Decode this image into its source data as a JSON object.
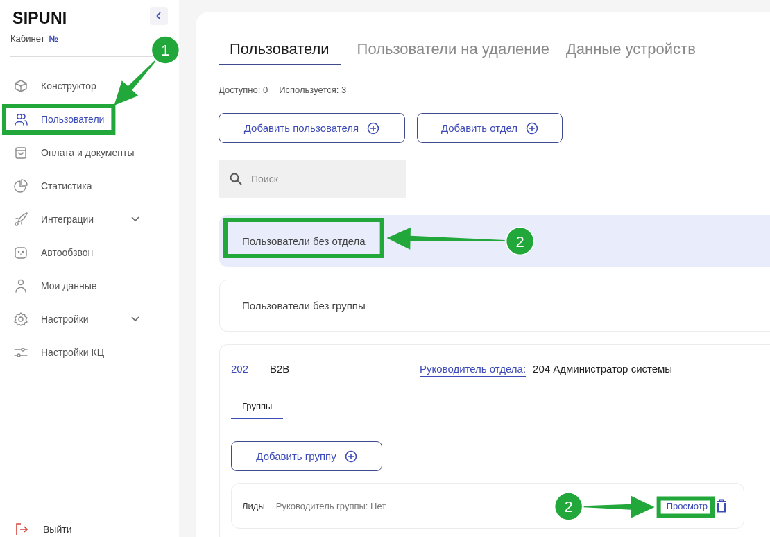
{
  "sidebar": {
    "logo": "SIPUNI",
    "account": {
      "label": "Кабинет",
      "sign": "№"
    },
    "nav": [
      {
        "label": "Конструктор",
        "kind": "link",
        "selected": false
      },
      {
        "label": "Пользователи",
        "kind": "link",
        "selected": true
      },
      {
        "label": "Оплата и документы",
        "kind": "link",
        "selected": false
      },
      {
        "label": "Статистика",
        "kind": "link",
        "selected": false
      },
      {
        "label": "Интеграции",
        "kind": "group",
        "selected": false,
        "expanded": false
      },
      {
        "label": "Автообзвон",
        "kind": "link",
        "selected": false
      },
      {
        "label": "Мои данные",
        "kind": "link",
        "selected": false
      },
      {
        "label": "Настройки",
        "kind": "group",
        "selected": false,
        "expanded": false
      },
      {
        "label": "Настройки КЦ",
        "kind": "link",
        "selected": false
      }
    ],
    "logout": "Выйти"
  },
  "tabs": [
    {
      "label": "Пользователи",
      "selected": true
    },
    {
      "label": "Пользователи на удаление",
      "selected": false
    },
    {
      "label": "Данные устройств",
      "selected": false
    }
  ],
  "counters": [
    {
      "label": "Доступно:",
      "value": "0"
    },
    {
      "label": "Используется:",
      "value": "3"
    }
  ],
  "buttons": [
    "Добавить пользователя",
    "Добавить отдел"
  ],
  "search": {
    "placeholder": "Поиск"
  },
  "departments": [
    {
      "kind": "plain",
      "name": "Пользователи без отдела",
      "selected": true
    },
    {
      "kind": "plain",
      "name": "Пользователи без группы",
      "selected": false
    },
    {
      "kind": "department",
      "number": "202",
      "name": "B2B",
      "selected": false,
      "head_label": "Руководитель отдела:",
      "head_value": "204 Администратор системы",
      "subtabs": [
        {
          "label": "Группы",
          "selected": true
        }
      ],
      "add_button": "Добавить группу",
      "groups": [
        {
          "name": "Лиды",
          "head_label": "Руководитель группы:",
          "head_value": "Нет",
          "view_link": "Просмотр"
        }
      ]
    }
  ],
  "callouts": [
    {
      "number": "1"
    },
    {
      "number": "2"
    },
    {
      "number": "2"
    }
  ]
}
